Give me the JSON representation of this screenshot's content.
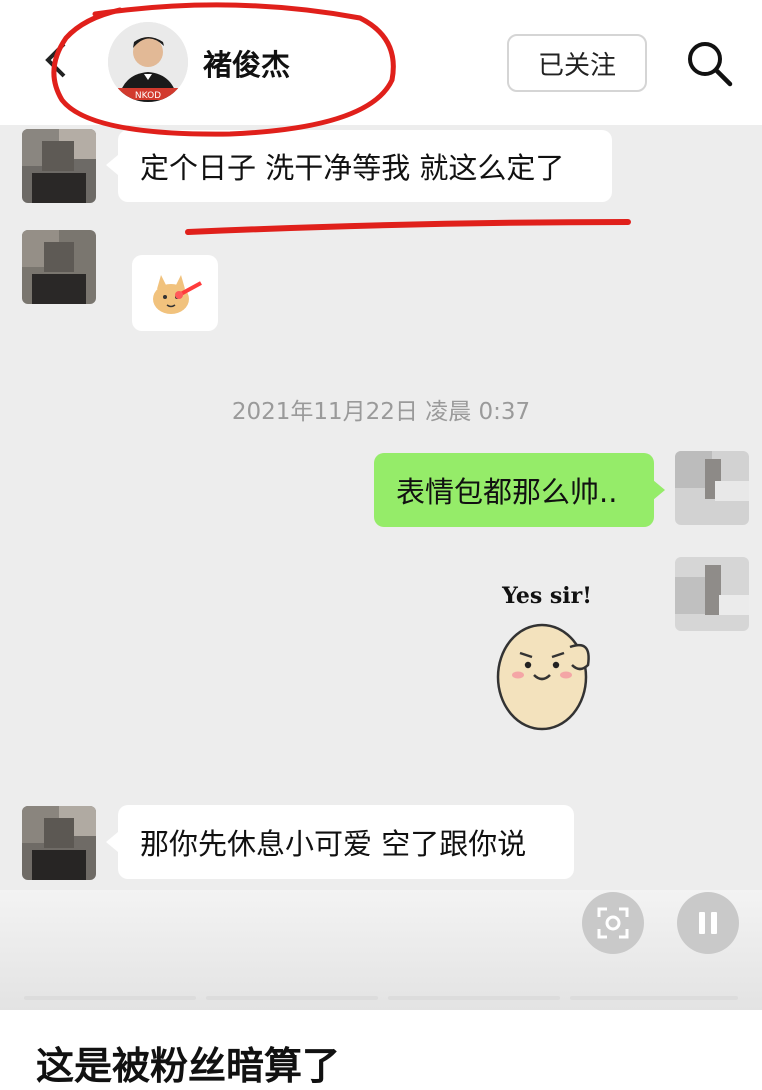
{
  "header": {
    "contact_name": "褚俊杰",
    "follow_label": "已关注",
    "back_icon": "chevron-left-icon",
    "search_icon": "search-icon"
  },
  "messages": [
    {
      "side": "left",
      "type": "text",
      "text": "定个日子 洗干净等我 就这么定了"
    },
    {
      "side": "left",
      "type": "sticker",
      "sticker": "dog-face-sticker"
    },
    {
      "type": "timestamp",
      "text": "2021年11月22日 凌晨 0:37"
    },
    {
      "side": "right",
      "type": "text",
      "text": "表情包都那么帅.."
    },
    {
      "side": "right",
      "type": "sticker",
      "sticker": "potato-salute-sticker",
      "caption": "Yes sir!"
    },
    {
      "side": "left",
      "type": "text",
      "text": "那你先休息小可爱 空了跟你说"
    }
  ],
  "controls": {
    "scan_icon": "scan-icon",
    "pause_icon": "pause-icon"
  },
  "caption": "这是被粉丝暗算了",
  "colors": {
    "sent_bubble": "#95ec69",
    "chat_bg": "#ededed",
    "annotation": "#e0201b"
  }
}
